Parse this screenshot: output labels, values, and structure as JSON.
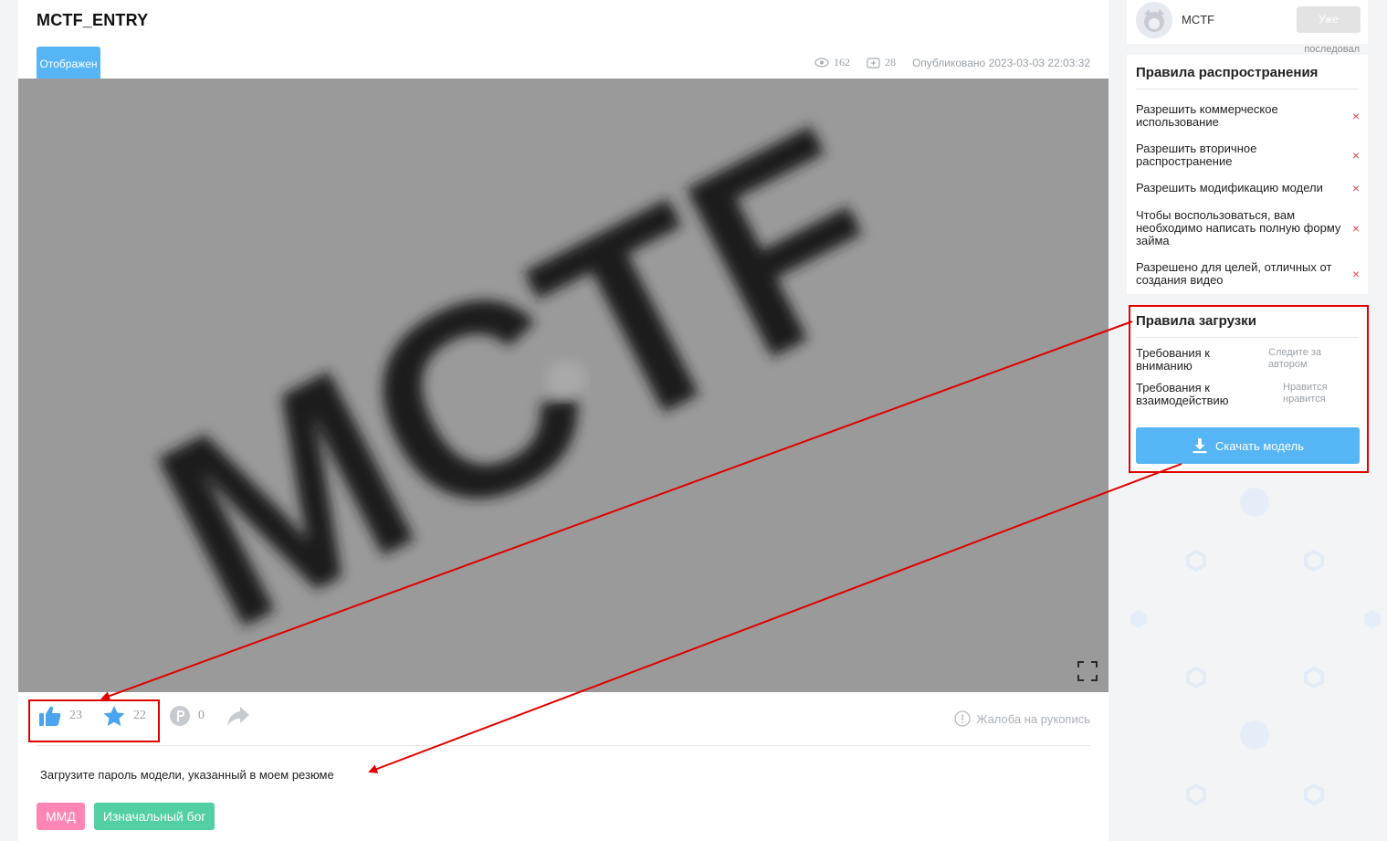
{
  "page": {
    "title": "MCTF_ENTRY",
    "status_chip": "Отображен"
  },
  "meta": {
    "views": "162",
    "comments": "28",
    "published": "Опубликовано 2023-03-03 22:03:32"
  },
  "preview": {
    "watermark": "MCTF"
  },
  "actions": {
    "likes": "23",
    "favorites": "22",
    "points": "0",
    "report": "Жалоба на рукопись"
  },
  "description": "Загрузите пароль модели, указанный в моем резюме",
  "tags": [
    {
      "label": "ММД",
      "color": "#ff86b4"
    },
    {
      "label": "Изначальный бог",
      "color": "#52d0a4"
    }
  ],
  "author": {
    "name": "MCTF",
    "follow_label": "Уже",
    "follow_note": "последовал"
  },
  "distribution_rules": {
    "title": "Правила распространения",
    "items": [
      {
        "label": "Разрешить коммерческое использование",
        "allowed": "×"
      },
      {
        "label": "Разрешить вторичное распространение",
        "allowed": "×"
      },
      {
        "label": "Разрешить модификацию модели",
        "allowed": "×"
      },
      {
        "label": "Чтобы воспользоваться, вам необходимо написать полную форму займа",
        "allowed": "×"
      },
      {
        "label": "Разрешено для целей, отличных от создания видео",
        "allowed": "×"
      }
    ]
  },
  "upload_rules": {
    "title": "Правила загрузки",
    "attention_label": "Требования к вниманию",
    "attention_value": "Следите за автором",
    "interaction_label": "Требования к взаимодействию",
    "interaction_value": "Нравится нравится",
    "download_label": "Скачать модель"
  },
  "colors": {
    "accent": "#56b5f5",
    "annotation": "#e00000",
    "deny": "#e84b4b"
  }
}
